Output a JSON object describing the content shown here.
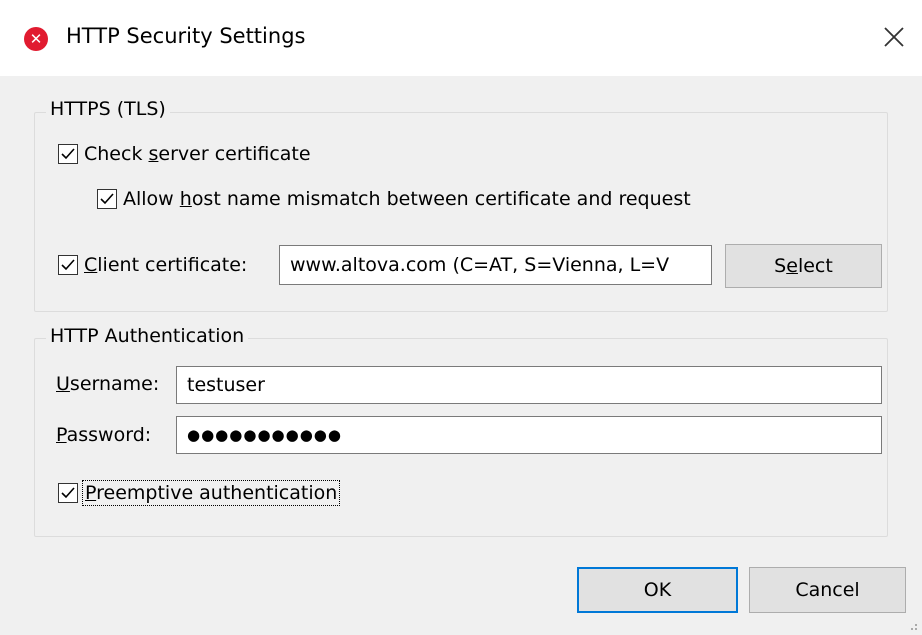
{
  "window": {
    "title": "HTTP Security Settings",
    "app_icon": "altova-x-icon",
    "close_icon": "close-icon"
  },
  "https_group": {
    "title": "HTTPS (TLS)",
    "check_server_cert": {
      "label_pre": "Check ",
      "label_u": "s",
      "label_post": "erver certificate",
      "checked": true
    },
    "allow_mismatch": {
      "label_pre": "Allow ",
      "label_u": "h",
      "label_post": "ost name mismatch between certificate and request",
      "checked": true
    },
    "client_cert": {
      "label_pre": "",
      "label_u": "C",
      "label_post": "lient certificate:",
      "checked": true,
      "value": "www.altova.com (C=AT, S=Vienna, L=V"
    },
    "select_button": {
      "label_pre": "S",
      "label_u": "e",
      "label_post": "lect"
    }
  },
  "auth_group": {
    "title": "HTTP Authentication",
    "username": {
      "label_u": "U",
      "label_post": "sername:",
      "value": "testuser"
    },
    "password": {
      "label_u": "P",
      "label_post": "assword:",
      "value": "●●●●●●●●●●●"
    },
    "preemptive": {
      "label_u": "P",
      "label_post": "reemptive authentication",
      "checked": true
    }
  },
  "buttons": {
    "ok": "OK",
    "cancel": "Cancel"
  },
  "colors": {
    "accent": "#0078d7",
    "icon_red": "#e11b30",
    "dialog_bg": "#f0f0f0"
  }
}
